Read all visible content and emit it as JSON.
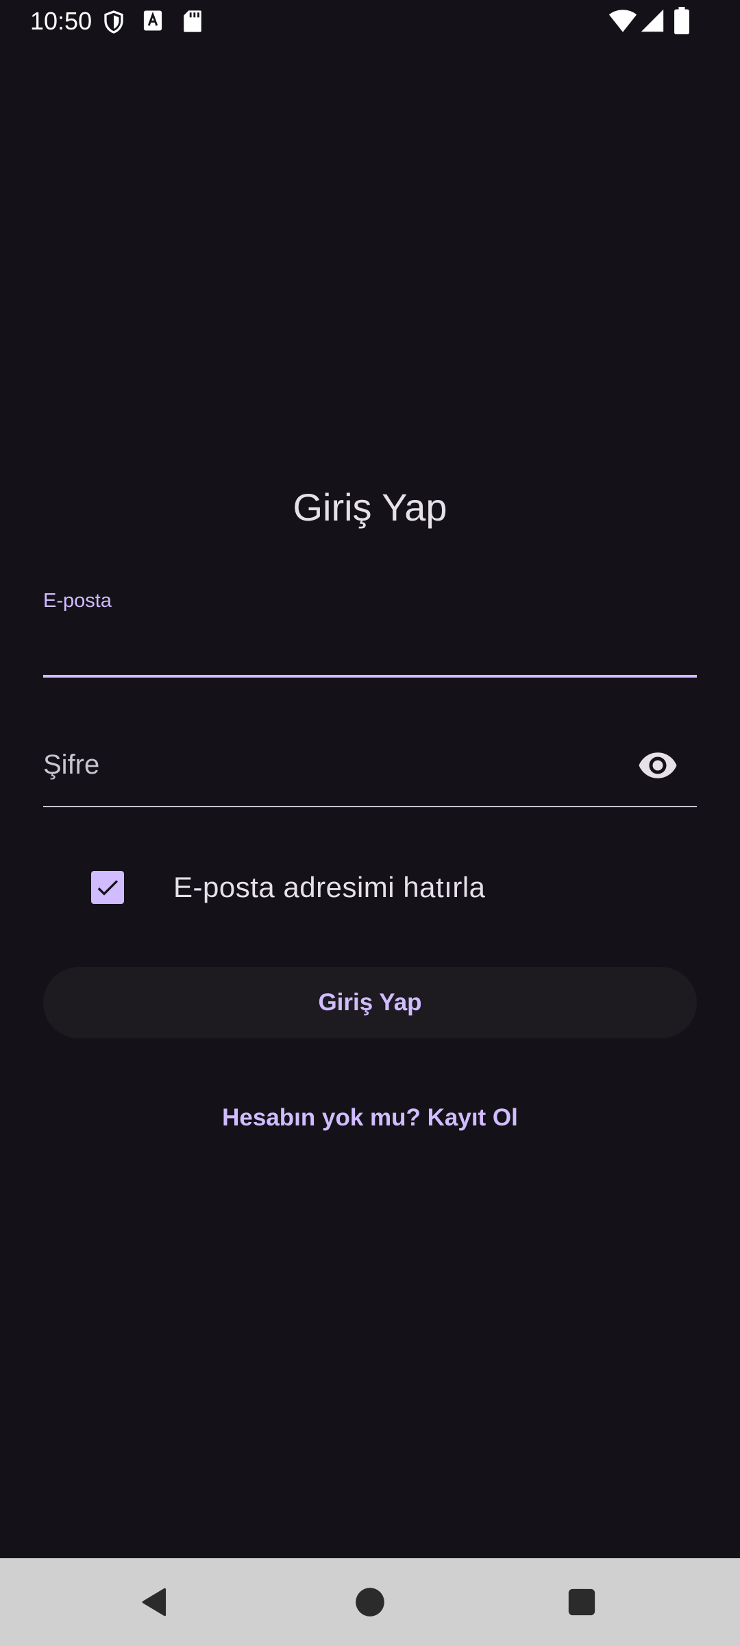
{
  "status_bar": {
    "time": "10:50",
    "left_icons": [
      "shield-icon",
      "a-letter-icon",
      "sd-card-icon"
    ],
    "right_icons": [
      "wifi-icon",
      "cell-signal-icon",
      "battery-icon"
    ]
  },
  "login": {
    "title": "Giriş Yap",
    "email_label": "E-posta",
    "email_value": "",
    "password_placeholder": "Şifre",
    "password_value": "",
    "remember_checked": true,
    "remember_label": "E-posta adresimi hatırla",
    "submit_label": "Giriş Yap",
    "register_link": "Hesabın yok mu? Kayıt Ol"
  },
  "nav_bar": {
    "buttons": [
      "back-icon",
      "home-icon",
      "recents-icon"
    ]
  },
  "colors": {
    "background": "#141218",
    "accent": "#d0bcff",
    "on_surface": "#e6e0e9",
    "button_surface": "#1d1b20",
    "nav_bar": "#d0d0d0"
  }
}
